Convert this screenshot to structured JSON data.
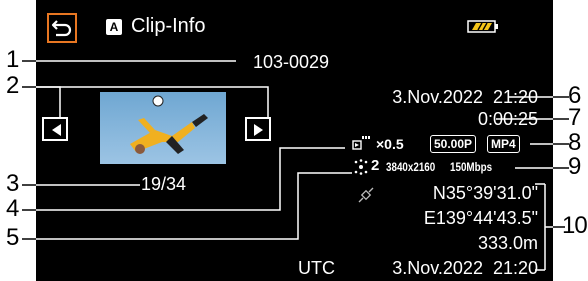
{
  "header": {
    "mode_badge": "A",
    "title": "Clip-Info",
    "back_icon": "return-icon",
    "battery_icon": "battery-icon"
  },
  "clip": {
    "number": "103-0029",
    "index": "19/34",
    "thumbnail": "soccer-player-bicycle-kick"
  },
  "info": {
    "date_time": "3.Nov.2022  21:20",
    "duration": "0:00:25",
    "slow_fast": "×0.5",
    "frame_rate": "50.00P",
    "format": "MP4",
    "scene_rec": "2",
    "resolution": "3840x2160",
    "bitrate": "150Mbps",
    "latitude": "N35°39'31.0\"",
    "longitude": "E139°44'43.5\"",
    "altitude": "333.0m",
    "utc_label": "UTC",
    "utc_date_time": "3.Nov.2022  21:20"
  },
  "callouts": [
    "1",
    "2",
    "3",
    "4",
    "5",
    "6",
    "7",
    "8",
    "9",
    "10"
  ],
  "colors": {
    "accent": "#e87722",
    "battery": "#f5c518",
    "screen_bg": "#000000"
  }
}
